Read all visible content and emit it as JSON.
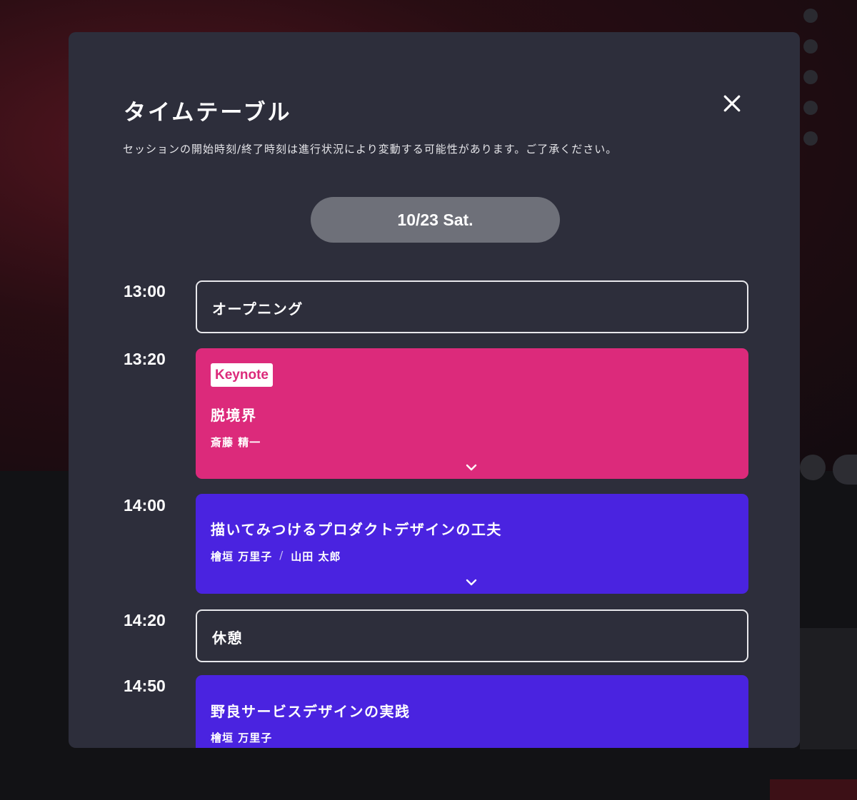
{
  "modal": {
    "title": "タイムテーブル",
    "notice": "セッションの開始時刻/終了時刻は進行状況により変動する可能性があります。ご了承ください。",
    "close_icon": "close-icon",
    "date_tab": "10/23 Sat."
  },
  "sessions": [
    {
      "time": "13:00",
      "title": "オープニング",
      "type": "plain"
    },
    {
      "time": "13:20",
      "badge": "Keynote",
      "title": "脱境界",
      "speakers": [
        "斎藤 精一"
      ],
      "type": "keynote",
      "expand_icon": "chevron-down-icon"
    },
    {
      "time": "14:00",
      "title": "描いてみつけるプロダクトデザインの工夫",
      "speakers": [
        "檜垣 万里子",
        "山田 太郎"
      ],
      "separator": "/",
      "type": "talk",
      "expand_icon": "chevron-down-icon"
    },
    {
      "time": "14:20",
      "title": "休憩",
      "type": "plain"
    },
    {
      "time": "14:50",
      "title": "野良サービスデザインの実践",
      "speakers": [
        "檜垣 万里子"
      ],
      "type": "talk"
    }
  ],
  "colors": {
    "modal_bg": "#2d2e3b",
    "keynote": "#dc2a7b",
    "talk": "#4a23e0",
    "date_tab": "#6e7079"
  }
}
